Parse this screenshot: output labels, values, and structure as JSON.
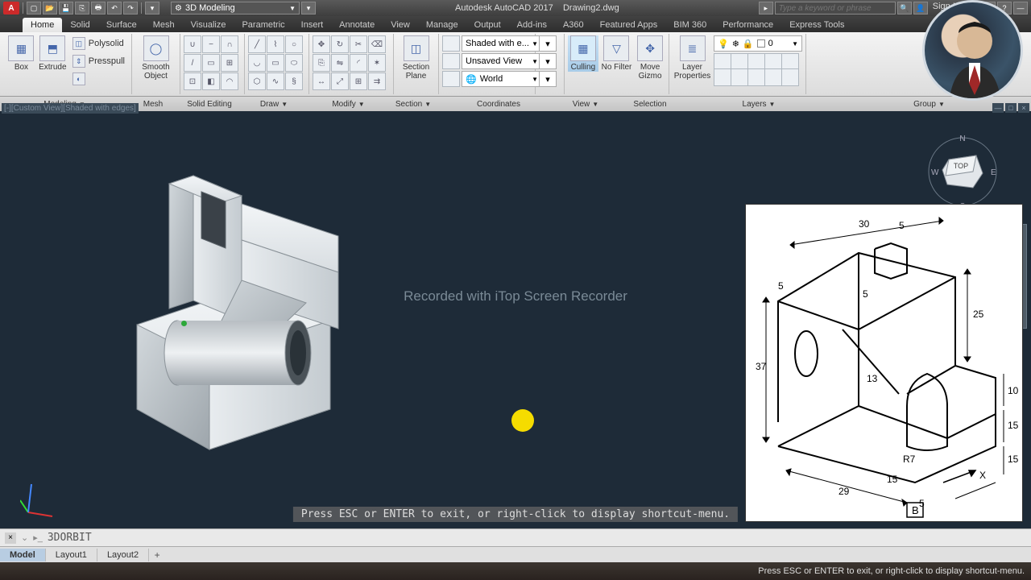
{
  "app": {
    "title_left": "Autodesk AutoCAD 2017",
    "title_right": "Drawing2.dwg",
    "workspace": "3D Modeling",
    "search_placeholder": "Type a keyword or phrase",
    "signin": "Sign In"
  },
  "tabs": [
    "Home",
    "Solid",
    "Surface",
    "Mesh",
    "Visualize",
    "Parametric",
    "Insert",
    "Annotate",
    "View",
    "Manage",
    "Output",
    "Add-ins",
    "A360",
    "Featured Apps",
    "BIM 360",
    "Performance",
    "Express Tools"
  ],
  "active_tab": "Home",
  "ribbon": {
    "box": "Box",
    "extrude": "Extrude",
    "polysolid": "Polysolid",
    "presspull": "Presspull",
    "smoothobj": "Smooth Object",
    "sectionplane": "Section Plane",
    "visual_style": "Shaded with e...",
    "saved_view": "Unsaved View",
    "coord_sys": "World",
    "culling": "Culling",
    "nofilter": "No Filter",
    "movegizmo": "Move Gizmo",
    "layerprops": "Layer Properties",
    "layer_value": "0"
  },
  "panels": [
    "Modeling",
    "Mesh",
    "Solid Editing",
    "Draw",
    "Modify",
    "Section",
    "Coordinates",
    "View",
    "Selection",
    "Layers",
    "Group"
  ],
  "viewport": {
    "view_label": "[-][Custom View][Shaded with edges]",
    "watermark": "Recorded with iTop Screen Recorder",
    "cmd_hint": "Press ESC or ENTER to exit, or right-click to display shortcut-menu.",
    "viewcube_face": "TOP",
    "compass": {
      "n": "N",
      "s": "S",
      "e": "E",
      "w": "W"
    }
  },
  "cmdline": {
    "command": "3DORBIT"
  },
  "model_tabs": [
    "Model",
    "Layout1",
    "Layout2"
  ],
  "active_model_tab": "Model",
  "statusbar": {
    "hint": "Press ESC or ENTER to exit, or right-click to display shortcut-menu."
  },
  "refdrawing": {
    "label": "B",
    "axis": "X",
    "dims": {
      "top_len": "30",
      "top_notch": "5",
      "front_h": "37",
      "front_base": "29",
      "right_h": "25",
      "right_step1": "10",
      "right_step2": "15",
      "right_step3": "15",
      "slot_r": "R7",
      "slot_off": "15",
      "rib": "13",
      "rib_t": "5",
      "base_t": "5",
      "ledge": "5"
    }
  }
}
